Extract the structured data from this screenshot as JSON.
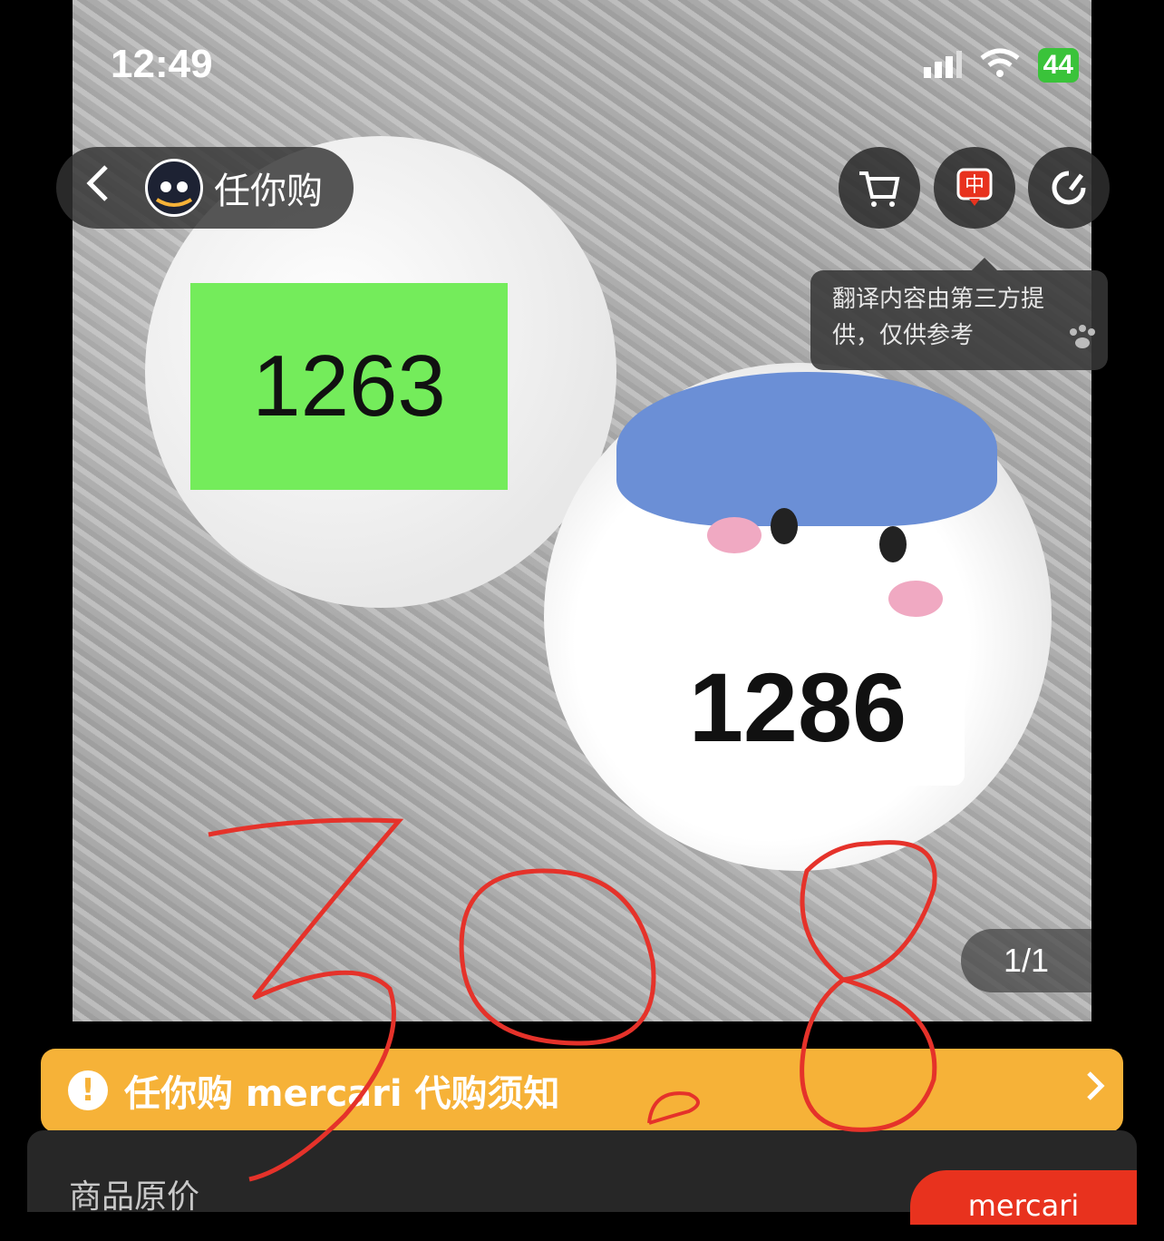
{
  "status_bar": {
    "time": "12:49",
    "battery": "44"
  },
  "header": {
    "back_icon": "chevron-left-icon",
    "app_name": "任你购",
    "actions": [
      "cart-icon",
      "translate-icon",
      "share-icon"
    ]
  },
  "tooltip": {
    "line1": "翻译内容由第三方提",
    "line2": "供，仅供参考"
  },
  "photo": {
    "label_1": "1263",
    "label_2": "1286",
    "counter": "1/1"
  },
  "handwritten_note": "308",
  "notice": {
    "text": "任你购 mercari 代购须知"
  },
  "panel": {
    "price_label": "商品原价",
    "badge": "mercari"
  },
  "colors": {
    "notice": "#f6b238",
    "label_green": "#74ec5b",
    "badge_red": "#e8321e",
    "scribble": "#e5322a"
  }
}
